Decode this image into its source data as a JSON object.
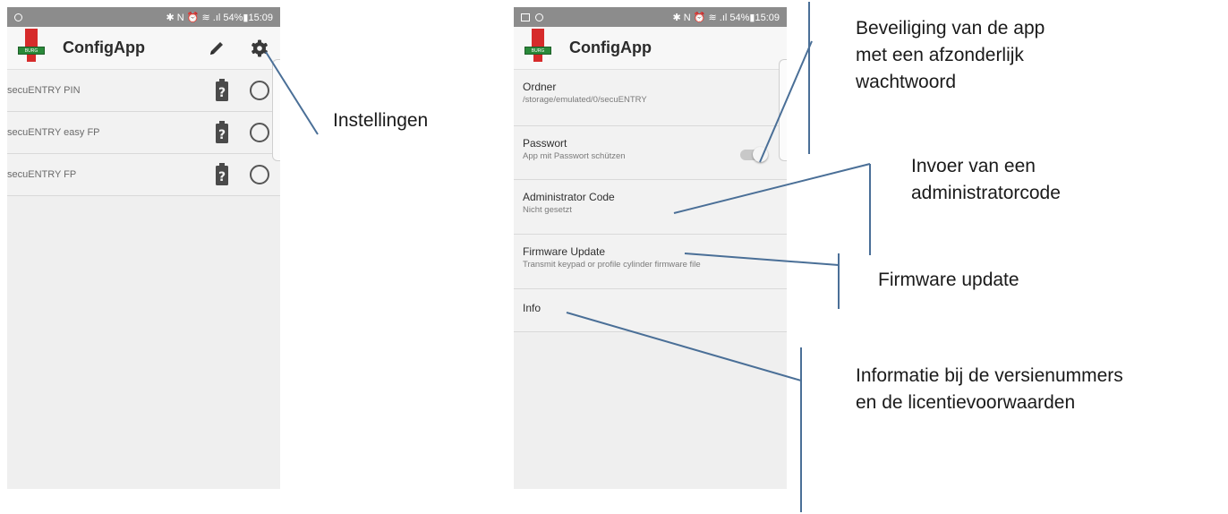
{
  "left_screen": {
    "status": {
      "right": "✱ N ⏰ ≋ .ıl 54%▮15:09"
    },
    "app_title": "ConfigApp",
    "logo_text": "BURG WÄCHTER",
    "devices": [
      {
        "name": "secuENTRY PIN"
      },
      {
        "name": "secuENTRY easy FP"
      },
      {
        "name": "secuENTRY FP"
      }
    ]
  },
  "right_screen": {
    "status": {
      "right": "✱ N ⏰ ≋ .ıl 54%▮15:09"
    },
    "app_title": "ConfigApp",
    "logo_text": "BURG WÄCHTER",
    "settings": [
      {
        "title": "Ordner",
        "subtitle": "/storage/emulated/0/secuENTRY"
      },
      {
        "title": "Passwort",
        "subtitle": "App mit Passwort schützen",
        "toggle": false
      },
      {
        "title": "Administrator Code",
        "subtitle": "Nicht gesetzt"
      },
      {
        "title": "Firmware Update",
        "subtitle": "Transmit keypad or profile cylinder firmware file"
      },
      {
        "title": "Info",
        "subtitle": ""
      }
    ]
  },
  "annotations": {
    "instellingen": "Instellingen",
    "beveiliging": [
      "Beveiliging van de app",
      "met een afzonderlijk",
      "wachtwoord"
    ],
    "admin": [
      "Invoer van een",
      "administratorcode"
    ],
    "firmware": "Firmware update",
    "info": [
      "Informatie bij de versienummers",
      "en de licentievoorwaarden"
    ]
  },
  "colors": {
    "leader_line": "#4a6f97",
    "status_bar": "#8c8c8c"
  }
}
